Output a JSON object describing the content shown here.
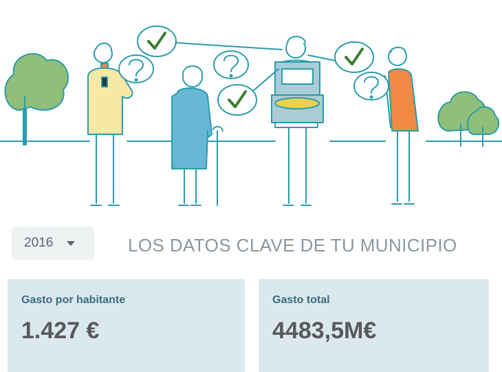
{
  "filter": {
    "year": "2016"
  },
  "header": {
    "title": "LOS DATOS CLAVE DE TU MUNICIPIO"
  },
  "kpis": [
    {
      "label": "Gasto por habitante",
      "value": "1.427 €"
    },
    {
      "label": "Gasto total",
      "value": "4483,5M€"
    }
  ],
  "illustration": {
    "icons": [
      "tree-icon",
      "person-icon",
      "question-bubble-icon",
      "check-bubble-icon",
      "ballot-box-icon",
      "cane-icon"
    ],
    "colors": {
      "line": "#2a9cab",
      "tree": "#8fbf78",
      "check": "#3c7d34",
      "yellow": "#f8e8a5",
      "blue": "#67b7d5",
      "orange": "#f08a45"
    }
  }
}
